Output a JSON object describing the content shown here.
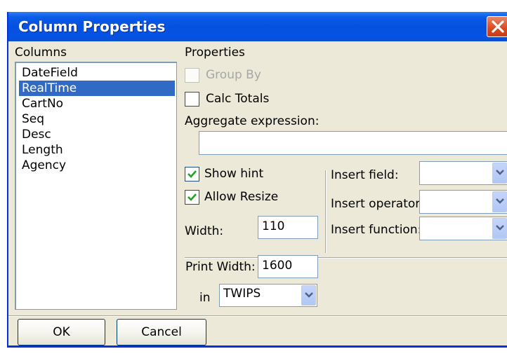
{
  "window": {
    "title": "Column Properties"
  },
  "columns": {
    "label": "Columns",
    "items": [
      "DateField",
      "RealTime",
      "CartNo",
      "Seq",
      "Desc",
      "Length",
      "Agency"
    ],
    "selected": "RealTime"
  },
  "properties": {
    "label": "Properties",
    "group_by": {
      "label": "Group By",
      "checked": false,
      "enabled": false
    },
    "calc_totals": {
      "label": "Calc Totals",
      "checked": false
    },
    "aggregate_label": "Aggregate expression:",
    "aggregate_value": "",
    "show_hint": {
      "label": "Show hint",
      "checked": true
    },
    "allow_resize": {
      "label": "Allow Resize",
      "checked": true
    },
    "width_label": "Width:",
    "width_value": "110",
    "insert_field_label": "Insert field:",
    "insert_operator_label": "Insert operator:",
    "insert_function_label": "Insert function:",
    "print_width_label": "Print Width:",
    "print_width_value": "1600",
    "in_label": "in",
    "unit_value": "TWIPS"
  },
  "buttons": {
    "ok": "OK",
    "cancel": "Cancel"
  },
  "colors": {
    "titlebar": "#0553e3",
    "selection": "#316ac5",
    "face": "#ece9d8",
    "check": "#21a121"
  }
}
